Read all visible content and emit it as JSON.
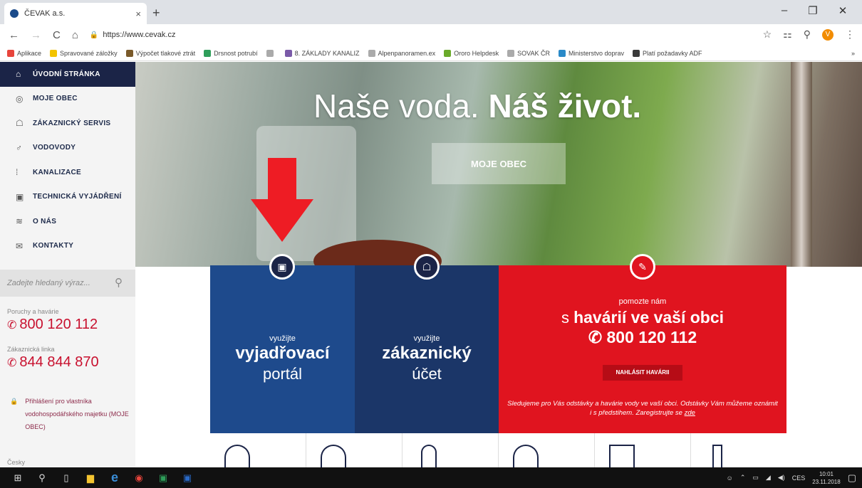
{
  "browser": {
    "tab_title": "ČEVAK a.s.",
    "tab_close": "×",
    "new_tab": "+",
    "url": "https://www.cevak.cz",
    "window_controls": [
      "–",
      "❐",
      "✕"
    ],
    "bookmarks": [
      {
        "label": "Aplikace",
        "color": "#e8453c"
      },
      {
        "label": "Spravované záložky",
        "color": "#f3c400"
      },
      {
        "label": "Výpočet tlakové ztrát",
        "color": "#7a5a2a"
      },
      {
        "label": "Drsnost potrubí",
        "color": "#2e9e5a"
      },
      {
        "label": "",
        "color": "#aaaaaa"
      },
      {
        "label": "8. ZÁKLADY KANALIZ",
        "color": "#7a5aa8"
      },
      {
        "label": "Alpenpanoramen.ex",
        "color": "#aaaaaa"
      },
      {
        "label": "Ororo Helpdesk",
        "color": "#6aaa2a"
      },
      {
        "label": "SOVAK ČR",
        "color": "#aaaaaa"
      },
      {
        "label": "Ministerstvo doprav",
        "color": "#2a8ac8"
      },
      {
        "label": "Platí požadavky ADF",
        "color": "#3a3a3a"
      }
    ],
    "bookmarks_more": "»",
    "avatar_letter": "V"
  },
  "sidebar": {
    "items": [
      {
        "label": "ÚVODNÍ STRÁNKA",
        "icon": "⌂"
      },
      {
        "label": "MOJE OBEC",
        "icon": "◎"
      },
      {
        "label": "ZÁKAZNICKÝ SERVIS",
        "icon": "☖"
      },
      {
        "label": "VODOVODY",
        "icon": "♂"
      },
      {
        "label": "KANALIZACE",
        "icon": "⁞"
      },
      {
        "label": "TECHNICKÁ VYJÁDŘENÍ",
        "icon": "▣"
      },
      {
        "label": "O NÁS",
        "icon": "≋"
      },
      {
        "label": "KONTAKTY",
        "icon": "✉"
      }
    ],
    "search_placeholder": "Zadejte hledaný výraz...",
    "breakdowns_label": "Poruchy a havárie",
    "breakdowns_phone": "800 120 112",
    "customer_label": "Zákaznická linka",
    "customer_phone": "844 844 870",
    "owner_login": "Přihlášení pro vlastníka vodohospodářského majetku (MOJE OBEC)",
    "language": "Česky"
  },
  "hero": {
    "slogan_light": "Naše voda.",
    "slogan_bold": "Náš život.",
    "button": "MOJE OBEC"
  },
  "panels": {
    "portal": {
      "small": "využijte",
      "big": "vyjadřovací",
      "medium": "portál"
    },
    "account": {
      "small": "využijte",
      "big": "zákaznický",
      "medium": "účet"
    },
    "emergency": {
      "small": "pomozte nám",
      "line_pre": "s",
      "line_bold": "havárií ve vaší obci",
      "phone": "800 120 112",
      "button": "NAHLÁSIT HAVÁRII",
      "note": "Sledujeme pro Vás odstávky a havárie vody ve vaší obci. Odstávky Vám můžeme oznámit i s předstihem. Zaregistrujte se",
      "note_link": "zde"
    }
  },
  "taskbar": {
    "tray": "CES",
    "time": "10:01",
    "date": "23.11.2018"
  },
  "colors": {
    "navy": "#1b2447",
    "blue": "#1e4a8c",
    "red": "#e0141f",
    "phone_red": "#c8102e"
  }
}
